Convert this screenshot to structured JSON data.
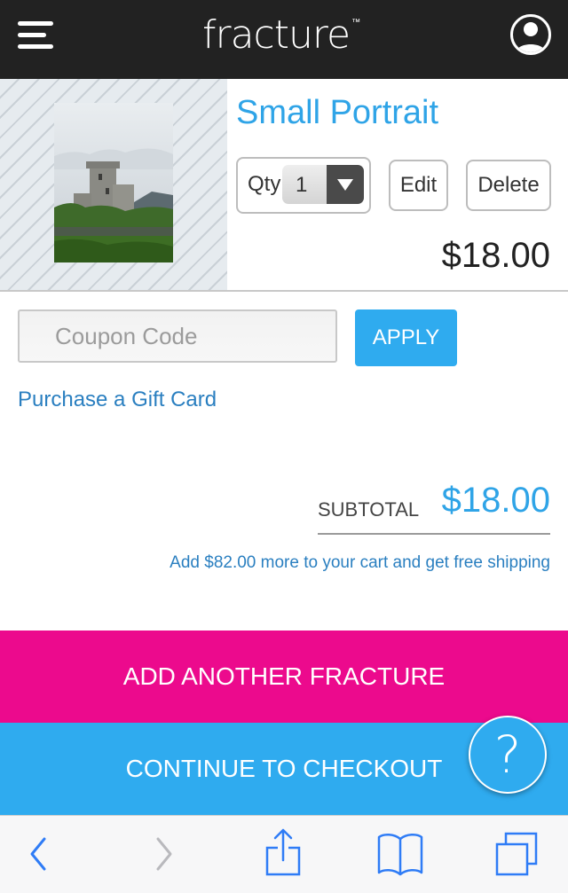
{
  "header": {
    "logo_text": "fracture",
    "logo_tm": "™"
  },
  "cart_item": {
    "title": "Small Portrait",
    "qty_label": "Qty",
    "qty_value": "1",
    "edit_label": "Edit",
    "delete_label": "Delete",
    "price": "$18.00"
  },
  "coupon": {
    "placeholder": "Coupon Code",
    "apply_label": "APPLY"
  },
  "gift_card_link": "Purchase a Gift Card",
  "totals": {
    "subtotal_label": "SUBTOTAL",
    "subtotal_value": "$18.00",
    "free_shipping_note": "Add $82.00 more to your cart and get free shipping"
  },
  "actions": {
    "add_another_label": "ADD ANOTHER FRACTURE",
    "checkout_label": "CONTINUE TO CHECKOUT",
    "help_label": "?"
  },
  "colors": {
    "header_bg": "#222222",
    "accent_blue": "#2fabef",
    "link_blue": "#2a7fc0",
    "pink": "#ec0a8d"
  },
  "icons": {
    "menu": "hamburger-icon",
    "account": "user-icon",
    "back": "chevron-left-icon",
    "forward": "chevron-right-icon",
    "share": "share-icon",
    "bookmarks": "book-icon",
    "tabs": "tabs-icon"
  }
}
